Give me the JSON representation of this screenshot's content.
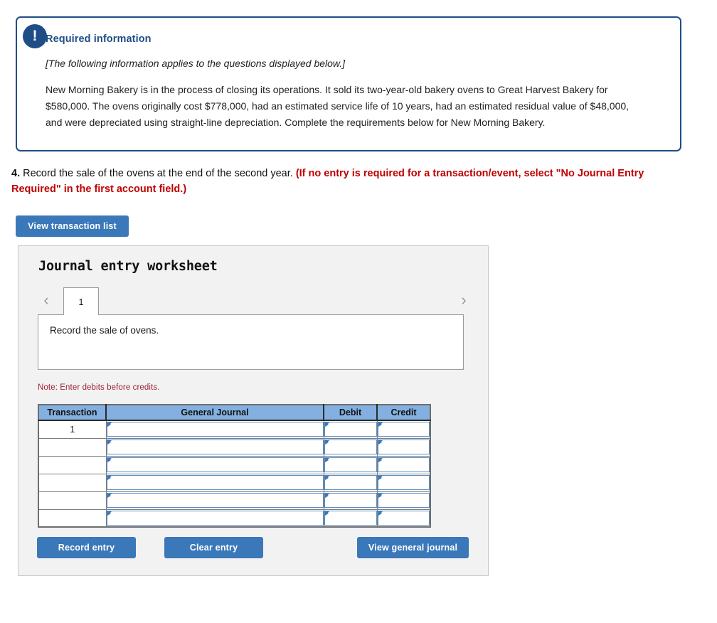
{
  "info_box": {
    "icon": "exclamation-icon",
    "title": "Required information",
    "italic_note": "[The following information applies to the questions displayed below.]",
    "body": "New Morning Bakery is in the process of closing its operations. It sold its two-year-old bakery ovens to Great Harvest Bakery for $580,000. The ovens originally cost $778,000, had an estimated service life of 10 years, had an estimated residual value of $48,000, and were depreciated using straight-line depreciation. Complete the requirements below for New Morning Bakery.",
    "border_color": "#1f4e87"
  },
  "question": {
    "number": "4.",
    "text": " Record the sale of the ovens at the end of the second year. ",
    "red_instruction": "(If no entry is required for a transaction/event, select \"No Journal Entry Required\" in the first account field.)",
    "red_color": "#c00000"
  },
  "toolbar": {
    "view_transaction_list_label": "View transaction list"
  },
  "worksheet": {
    "title": "Journal entry worksheet",
    "pager": {
      "prev_icon": "chevron-left-icon",
      "next_icon": "chevron-right-icon",
      "current_tab": "1"
    },
    "description": "Record the sale of ovens.",
    "note": "Note: Enter debits before credits.",
    "note_color": "#9b2335",
    "table": {
      "headers": [
        "Transaction",
        "General Journal",
        "Debit",
        "Credit"
      ],
      "header_bg": "#83b0e0",
      "rows": [
        {
          "transaction": "1",
          "general_journal": "",
          "debit": "",
          "credit": ""
        },
        {
          "transaction": "",
          "general_journal": "",
          "debit": "",
          "credit": ""
        },
        {
          "transaction": "",
          "general_journal": "",
          "debit": "",
          "credit": ""
        },
        {
          "transaction": "",
          "general_journal": "",
          "debit": "",
          "credit": ""
        },
        {
          "transaction": "",
          "general_journal": "",
          "debit": "",
          "credit": ""
        },
        {
          "transaction": "",
          "general_journal": "",
          "debit": "",
          "credit": ""
        }
      ]
    },
    "buttons": {
      "record_entry": "Record entry",
      "clear_entry": "Clear entry",
      "view_general_journal": "View general journal",
      "accent_color": "#3a78b9"
    }
  }
}
